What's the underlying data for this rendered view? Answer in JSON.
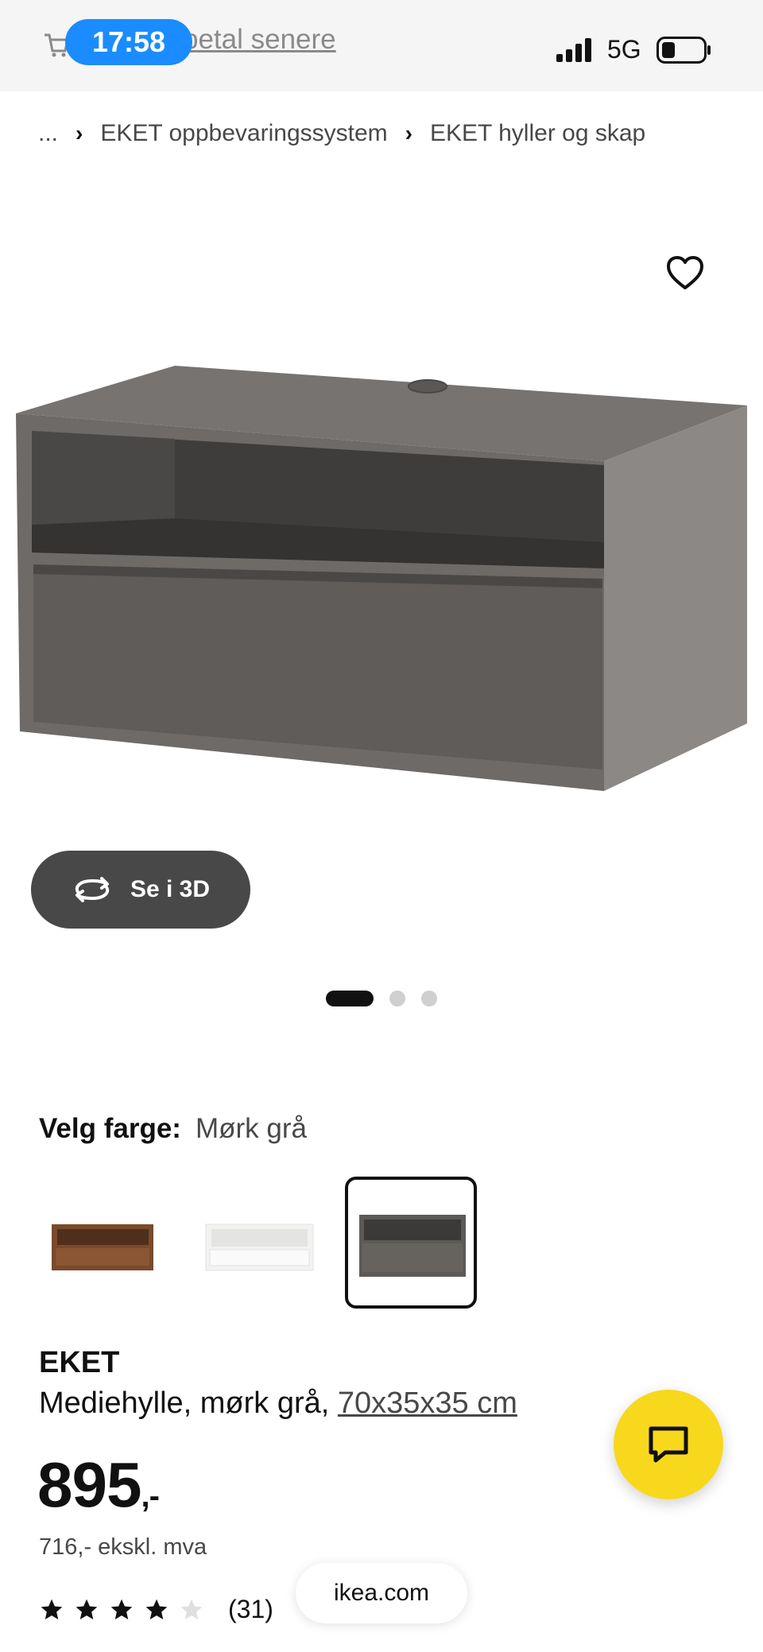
{
  "status_bar": {
    "time": "17:58",
    "promo_text": "betal senere",
    "network": "5G"
  },
  "breadcrumb": {
    "ellipsis": "...",
    "items": [
      "EKET oppbevaringssystem",
      "EKET hyller og skap"
    ]
  },
  "gallery": {
    "view_3d_label": "Se i 3D",
    "pages": 3,
    "active_page": 1
  },
  "color": {
    "label": "Velg farge:",
    "selected": "Mørk grå",
    "swatches": [
      {
        "name": "walnut-swatch",
        "color": "#7a4a2c"
      },
      {
        "name": "white-swatch",
        "color": "#f2f2f0"
      },
      {
        "name": "dark-grey-swatch",
        "color": "#5c5a58"
      }
    ]
  },
  "product": {
    "name": "EKET",
    "description": "Mediehylle, mørk grå, ",
    "dimensions": "70x35x35 cm",
    "price": "895",
    "price_suffix": ",-",
    "price_excl_vat": "716,- ekskl. mva",
    "rating": 4,
    "rating_max": 5,
    "review_count": "(31)"
  },
  "browser": {
    "url": "ikea.com"
  },
  "colors": {
    "accent_blue": "#1a8cff",
    "chat_yellow": "#f8d81c",
    "button_dark": "#484848"
  }
}
